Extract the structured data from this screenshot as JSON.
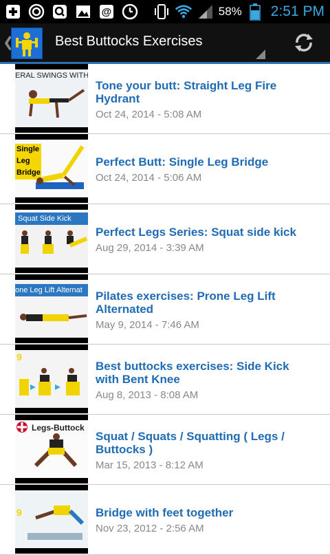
{
  "status_bar": {
    "icons_left": [
      "add-box-icon",
      "target-icon",
      "q-app-icon",
      "image-icon",
      "at-mail-icon",
      "clock-icon"
    ],
    "icons_right": [
      "vibrate-icon",
      "wifi-icon",
      "signal-icon"
    ],
    "battery_percent": "58%",
    "time": "2:51 PM",
    "colors": {
      "time": "#3aa8e0"
    }
  },
  "action_bar": {
    "title": "Best Buttocks Exercises",
    "refresh_icon": "refresh-icon",
    "back_icon": "chevron-left-icon"
  },
  "items": [
    {
      "title": "Tone your butt: Straight Leg Fire Hydrant",
      "date": "Oct 24, 2014 - 5:08 AM",
      "thumb_caption": "ERAL SWINGS WITH STRAIGHT"
    },
    {
      "title": "Perfect Butt: Single Leg Bridge",
      "date": "Oct 24, 2014 - 5:06 AM",
      "thumb_caption": "Single Leg Bridge"
    },
    {
      "title": "Perfect Legs Series: Squat side kick",
      "date": "Aug 29, 2014 - 3:39 AM",
      "thumb_caption": "Squat Side Kick"
    },
    {
      "title": "Pilates exercises: Prone Leg Lift Alternated",
      "date": "May 9, 2014 - 7:46 AM",
      "thumb_caption": "one Leg Lift Alternat"
    },
    {
      "title": "Best buttocks exercises: Side Kick with Bent Knee",
      "date": "Aug 8, 2013 - 8:08 AM",
      "thumb_caption": "9"
    },
    {
      "title": "Squat / Squats / Squatting ( Legs / Buttocks )",
      "date": "Mar 15, 2013 - 8:12 AM",
      "thumb_caption": "Legs-Buttock"
    },
    {
      "title": "Bridge with feet together",
      "date": "Nov 23, 2012 - 2:56 AM",
      "thumb_caption": "9"
    }
  ]
}
